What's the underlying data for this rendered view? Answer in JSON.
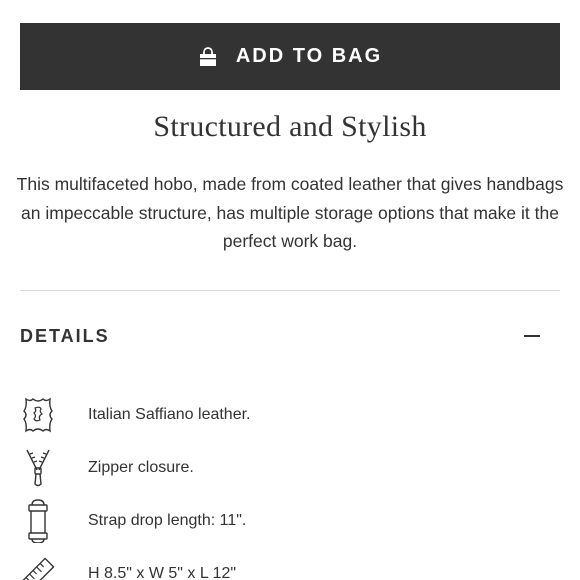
{
  "cta": {
    "label": "ADD TO BAG",
    "icon": "shopping-bag-icon"
  },
  "product": {
    "headline": "Structured and Stylish",
    "description": "This multifaceted hobo, made from coated leather that gives handbags an impeccable structure, has multiple storage options that make it the perfect work bag."
  },
  "details": {
    "title": "DETAILS",
    "toggle_icon": "minus-icon",
    "features": [
      {
        "icon": "leather-hide-icon",
        "text": "Italian Saffiano leather."
      },
      {
        "icon": "zipper-icon",
        "text": "Zipper closure."
      },
      {
        "icon": "strap-icon",
        "text": "Strap drop length: 11\"."
      },
      {
        "icon": "ruler-icon",
        "text": "H 8.5\" x W 5\" x L 12\""
      }
    ]
  },
  "colors": {
    "button_bg": "#333333",
    "text": "#333333",
    "divider": "#dcdcdc"
  }
}
